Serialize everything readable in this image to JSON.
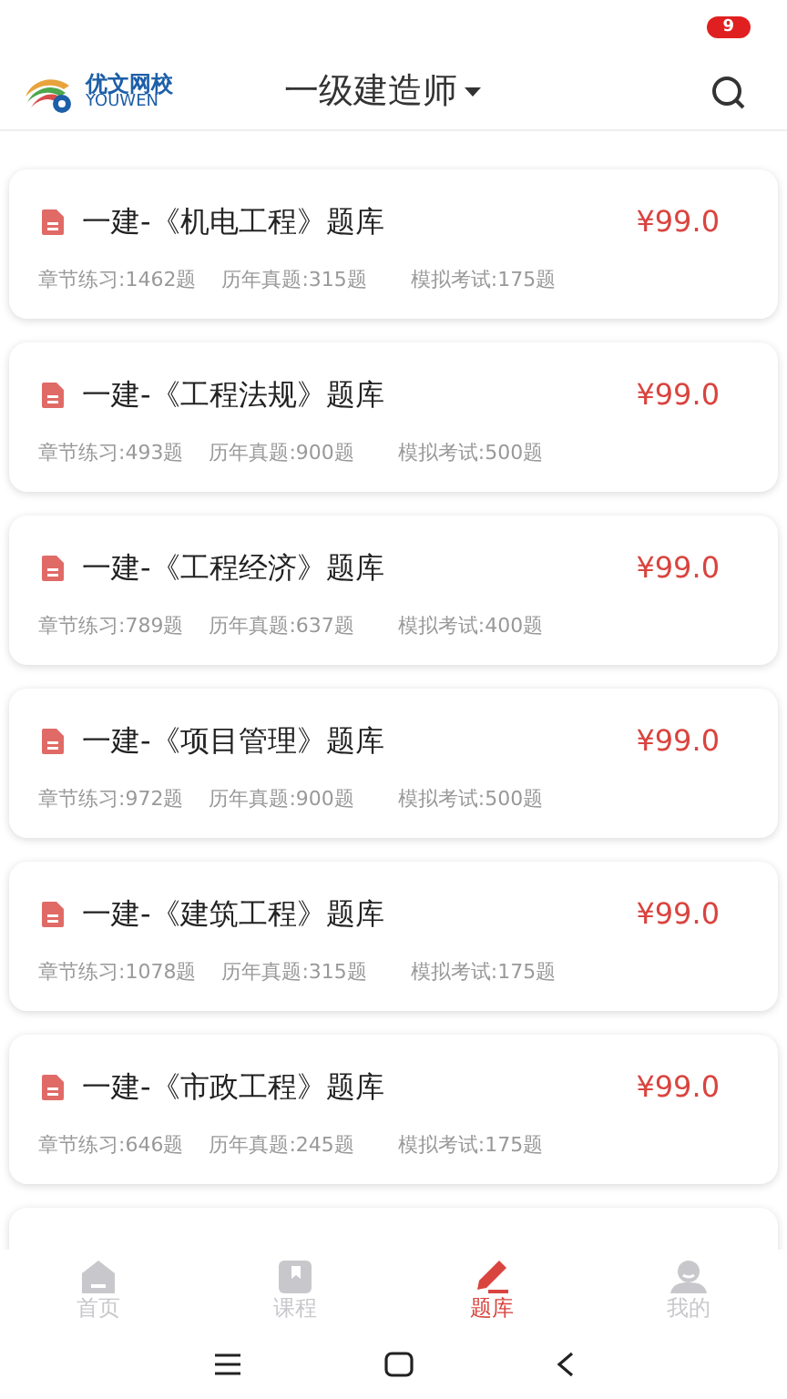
{
  "status_bar": {
    "badge": "9"
  },
  "header": {
    "logo_name": "优文网校",
    "logo_subtitle": "YOUWEN",
    "title": "一级建造师"
  },
  "banks": [
    {
      "title": "一建-《机电工程》题库",
      "price": "¥99.0",
      "stats": [
        "章节练习:1462题",
        "历年真题:315题",
        "模拟考试:175题"
      ]
    },
    {
      "title": "一建-《工程法规》题库",
      "price": "¥99.0",
      "stats": [
        "章节练习:493题",
        "历年真题:900题",
        "模拟考试:500题"
      ]
    },
    {
      "title": "一建-《工程经济》题库",
      "price": "¥99.0",
      "stats": [
        "章节练习:789题",
        "历年真题:637题",
        "模拟考试:400题"
      ]
    },
    {
      "title": "一建-《项目管理》题库",
      "price": "¥99.0",
      "stats": [
        "章节练习:972题",
        "历年真题:900题",
        "模拟考试:500题"
      ]
    },
    {
      "title": "一建-《建筑工程》题库",
      "price": "¥99.0",
      "stats": [
        "章节练习:1078题",
        "历年真题:315题",
        "模拟考试:175题"
      ]
    },
    {
      "title": "一建-《市政工程》题库",
      "price": "¥99.0",
      "stats": [
        "章节练习:646题",
        "历年真题:245题",
        "模拟考试:175题"
      ]
    }
  ],
  "tabs": [
    {
      "label": "首页",
      "kind": "home",
      "selected": false
    },
    {
      "label": "课程",
      "kind": "course",
      "selected": false
    },
    {
      "label": "题库",
      "kind": "bank",
      "selected": true
    },
    {
      "label": "我的",
      "kind": "me",
      "selected": false
    }
  ]
}
